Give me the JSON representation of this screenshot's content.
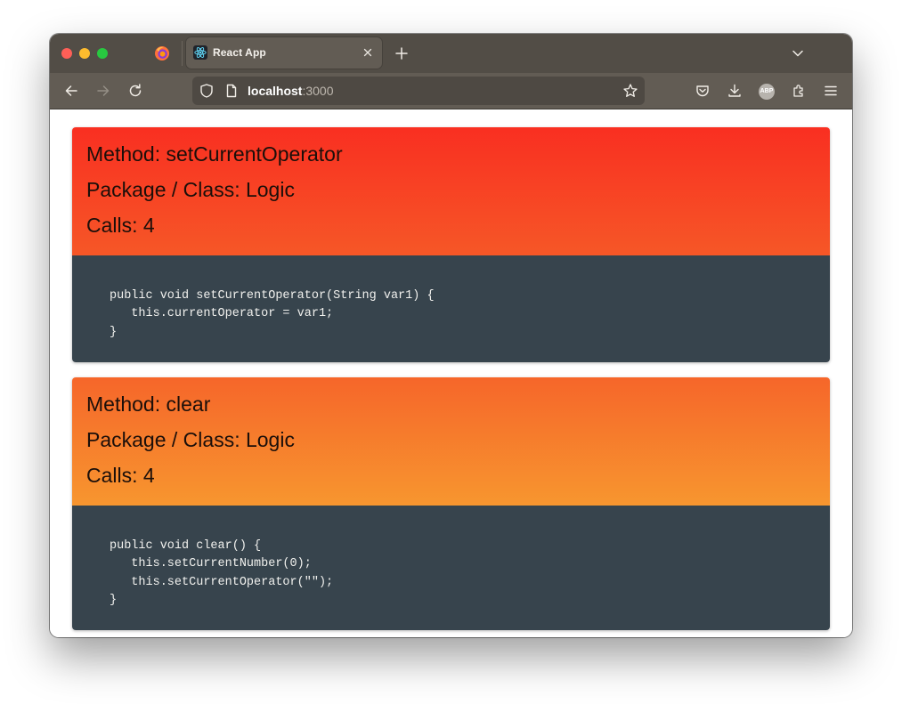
{
  "browser": {
    "tab": {
      "title": "React App"
    },
    "url": {
      "host": "localhost",
      "port": ":3000"
    },
    "extension_badge": "ABP",
    "icons": {
      "close": "red-close",
      "minimize": "yellow-minimize",
      "maximize": "green-maximize",
      "app": "firefox-icon",
      "tab_favicon": "react-icon",
      "back": "arrow-left-icon",
      "forward": "arrow-right-icon",
      "reload": "reload-icon",
      "site_info": "shield-icon",
      "page": "page-icon",
      "bookmark": "star-icon",
      "pocket": "pocket-icon",
      "downloads": "download-icon",
      "extensions": "puzzle-icon",
      "menu": "hamburger-icon"
    }
  },
  "colors": {
    "card1_header_top": "#f92f21",
    "card1_header_bottom": "#f65727",
    "card2_header_top": "#f6662a",
    "card2_header_bottom": "#f7962f",
    "code_background": "#37444d"
  },
  "cards": [
    {
      "method": "Method: setCurrentOperator",
      "package_class": "Package / Class: Logic",
      "calls": "Calls: 4",
      "code": "public void setCurrentOperator(String var1) {\n   this.currentOperator = var1;\n}"
    },
    {
      "method": "Method: clear",
      "package_class": "Package / Class: Logic",
      "calls": "Calls: 4",
      "code": "public void clear() {\n   this.setCurrentNumber(0);\n   this.setCurrentOperator(\"\");\n}"
    }
  ]
}
